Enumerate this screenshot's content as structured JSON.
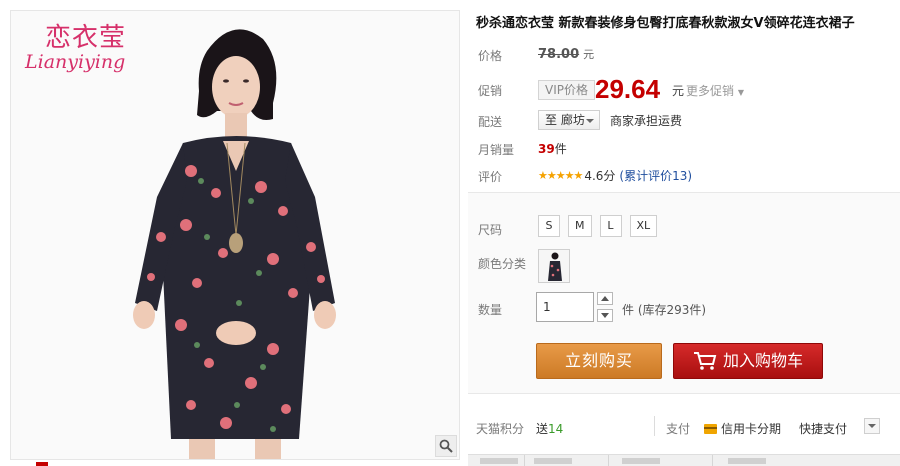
{
  "brand": {
    "name_cn": "恋衣莹",
    "name_en": "Lianyiying"
  },
  "product": {
    "title": "秒杀通恋衣莹 新款春装修身包臀打底春秋款淑女V领碎花连衣裙子"
  },
  "price": {
    "label": "价格",
    "original": "78.00",
    "unit": "元"
  },
  "promotion": {
    "label": "促销",
    "tag": "VIP价格",
    "price": "29.64",
    "unit": "元",
    "more": "更多促销"
  },
  "shipping": {
    "label": "配送",
    "destination": "至 廊坊",
    "note": "商家承担运费"
  },
  "sales": {
    "label": "月销量",
    "count": "39",
    "unit": "件"
  },
  "review": {
    "label": "评价",
    "stars": 4.6,
    "score": "4.6分",
    "link": "(累计评价13)"
  },
  "size": {
    "label": "尺码",
    "options": [
      "S",
      "M",
      "L",
      "XL"
    ]
  },
  "color": {
    "label": "颜色分类"
  },
  "quantity": {
    "label": "数量",
    "value": "1",
    "unit": "件",
    "stock": "(库存293件)"
  },
  "actions": {
    "buy_now": "立刻购买",
    "add_to_cart": "加入购物车"
  },
  "points": {
    "label": "天猫积分",
    "give": "送",
    "amount": "14"
  },
  "payment": {
    "label": "支付",
    "credit": "信用卡分期",
    "quick": "快捷支付"
  },
  "colors": {
    "price_red": "#c40000",
    "buy_orange": "#e89a48",
    "cart_red": "#d62a2a",
    "brand_pink": "#d6306a",
    "star_gold": "#f5a200",
    "link_blue": "#1f4e9e"
  }
}
